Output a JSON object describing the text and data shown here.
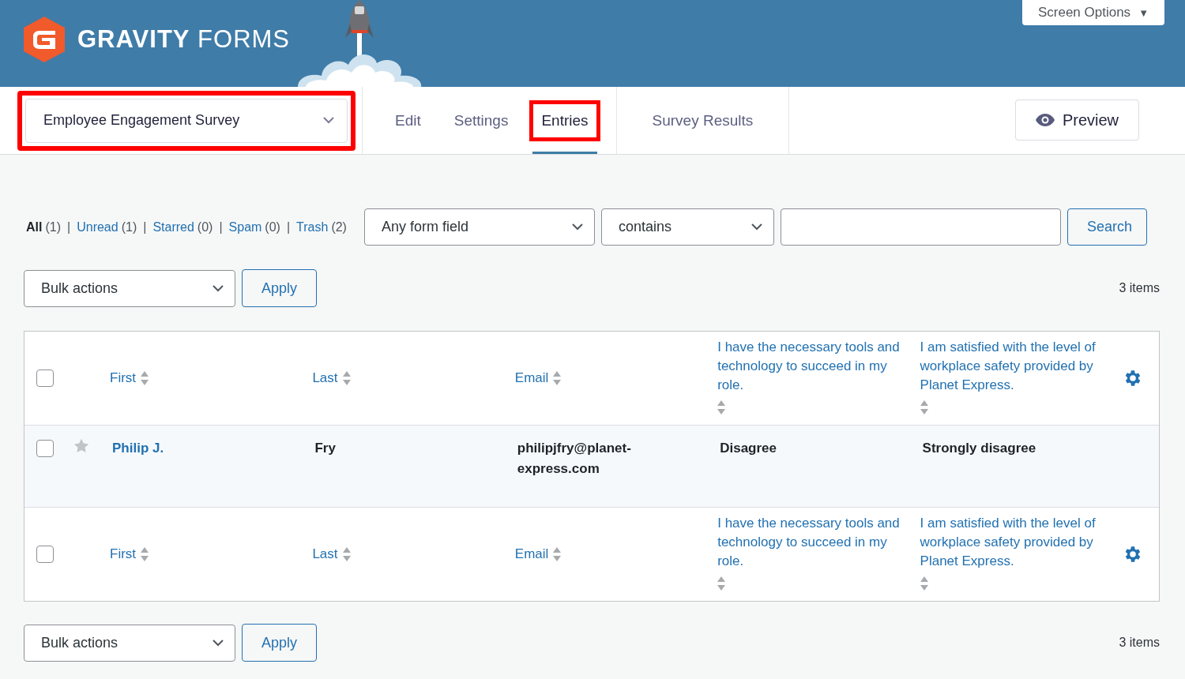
{
  "brand": {
    "name": "**GRAVITY** FORMS"
  },
  "screen_options": {
    "label": "Screen Options",
    "arrow": "▼"
  },
  "form_selector": {
    "value": "Employee Engagement Survey",
    "highlighted": true
  },
  "tabs": [
    {
      "label": "Edit",
      "selected": false,
      "highlighted": false
    },
    {
      "label": "Settings",
      "selected": false,
      "highlighted": false
    },
    {
      "label": "Entries",
      "selected": true,
      "highlighted": true
    },
    {
      "label": "Survey Results",
      "selected": false,
      "highlighted": false
    }
  ],
  "preview_button": {
    "label": "Preview"
  },
  "status_filters": [
    {
      "label": "All",
      "count": "(1)",
      "selected": true
    },
    {
      "label": "Unread",
      "count": "(1)",
      "selected": false
    },
    {
      "label": "Starred",
      "count": "(0)",
      "selected": false
    },
    {
      "label": "Spam",
      "count": "(0)",
      "selected": false
    },
    {
      "label": "Trash",
      "count": "(2)",
      "selected": false
    }
  ],
  "separator": "|",
  "search": {
    "field": "Any form field",
    "operator": "contains",
    "button": "Search"
  },
  "bulk_top": {
    "select": "Bulk actions",
    "apply": "Apply",
    "count": "3 items"
  },
  "table": {
    "header_checkbox": {
      "checked": false
    },
    "footer_checkbox": {
      "checked": false
    },
    "footer_columns": [
      "First",
      "Last",
      "Email",
      "I have the necessary tools and technology to succeed in my role.",
      "I am satisfied with the level of workplace safety provided by Planet Express."
    ],
    "columns": [
      "First",
      "Last",
      "Email",
      "I have the necessary tools and technology to succeed in my role.",
      "I am satisfied with the level of workplace safety provided by Planet Express."
    ],
    "rows": [
      {
        "checked": false,
        "starred": false,
        "cells": [
          "Philip J.",
          "Fry",
          "philipjfry@planet-express.com",
          "Disagree",
          "Strongly disagree"
        ]
      }
    ]
  },
  "bulk_bottom": {
    "select": "Bulk actions",
    "apply": "Apply",
    "count": "3 items"
  }
}
